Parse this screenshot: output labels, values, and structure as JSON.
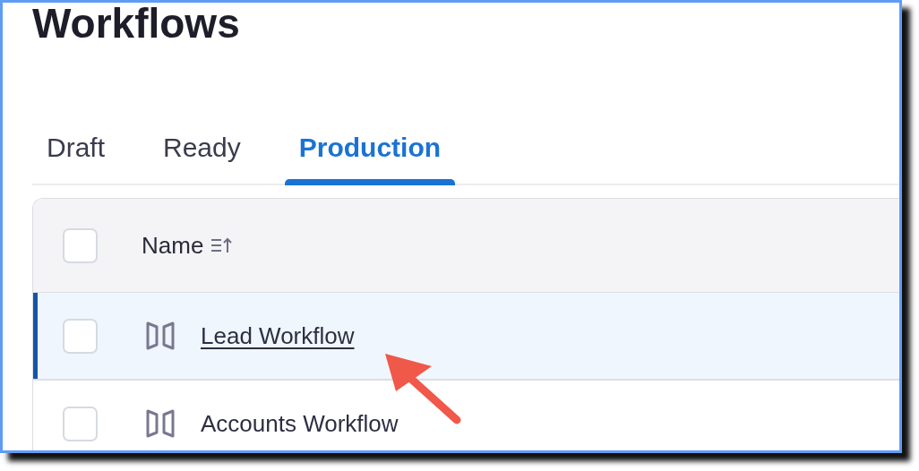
{
  "title": "Workflows",
  "tabs": [
    {
      "label": "Draft",
      "selected": false
    },
    {
      "label": "Ready",
      "selected": false
    },
    {
      "label": "Production",
      "selected": true
    }
  ],
  "table": {
    "columns": [
      {
        "label": "Name",
        "sorted": true
      }
    ],
    "all_checked": false,
    "rows": [
      {
        "name": "Lead Workflow",
        "checked": false,
        "selected": true
      },
      {
        "name": "Accounts Workflow",
        "checked": false,
        "selected": false
      }
    ]
  },
  "annotations": [
    {
      "kind": "arrow"
    }
  ]
}
